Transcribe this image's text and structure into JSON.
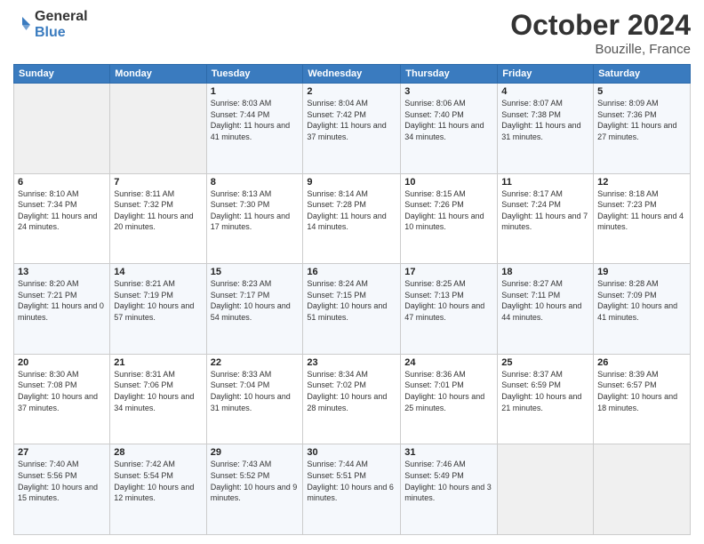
{
  "header": {
    "logo": {
      "general": "General",
      "blue": "Blue"
    },
    "title": "October 2024",
    "location": "Bouzille, France"
  },
  "weekdays": [
    "Sunday",
    "Monday",
    "Tuesday",
    "Wednesday",
    "Thursday",
    "Friday",
    "Saturday"
  ],
  "weeks": [
    [
      {
        "day": "",
        "info": ""
      },
      {
        "day": "",
        "info": ""
      },
      {
        "day": "1",
        "info": "Sunrise: 8:03 AM\nSunset: 7:44 PM\nDaylight: 11 hours and 41 minutes."
      },
      {
        "day": "2",
        "info": "Sunrise: 8:04 AM\nSunset: 7:42 PM\nDaylight: 11 hours and 37 minutes."
      },
      {
        "day": "3",
        "info": "Sunrise: 8:06 AM\nSunset: 7:40 PM\nDaylight: 11 hours and 34 minutes."
      },
      {
        "day": "4",
        "info": "Sunrise: 8:07 AM\nSunset: 7:38 PM\nDaylight: 11 hours and 31 minutes."
      },
      {
        "day": "5",
        "info": "Sunrise: 8:09 AM\nSunset: 7:36 PM\nDaylight: 11 hours and 27 minutes."
      }
    ],
    [
      {
        "day": "6",
        "info": "Sunrise: 8:10 AM\nSunset: 7:34 PM\nDaylight: 11 hours and 24 minutes."
      },
      {
        "day": "7",
        "info": "Sunrise: 8:11 AM\nSunset: 7:32 PM\nDaylight: 11 hours and 20 minutes."
      },
      {
        "day": "8",
        "info": "Sunrise: 8:13 AM\nSunset: 7:30 PM\nDaylight: 11 hours and 17 minutes."
      },
      {
        "day": "9",
        "info": "Sunrise: 8:14 AM\nSunset: 7:28 PM\nDaylight: 11 hours and 14 minutes."
      },
      {
        "day": "10",
        "info": "Sunrise: 8:15 AM\nSunset: 7:26 PM\nDaylight: 11 hours and 10 minutes."
      },
      {
        "day": "11",
        "info": "Sunrise: 8:17 AM\nSunset: 7:24 PM\nDaylight: 11 hours and 7 minutes."
      },
      {
        "day": "12",
        "info": "Sunrise: 8:18 AM\nSunset: 7:23 PM\nDaylight: 11 hours and 4 minutes."
      }
    ],
    [
      {
        "day": "13",
        "info": "Sunrise: 8:20 AM\nSunset: 7:21 PM\nDaylight: 11 hours and 0 minutes."
      },
      {
        "day": "14",
        "info": "Sunrise: 8:21 AM\nSunset: 7:19 PM\nDaylight: 10 hours and 57 minutes."
      },
      {
        "day": "15",
        "info": "Sunrise: 8:23 AM\nSunset: 7:17 PM\nDaylight: 10 hours and 54 minutes."
      },
      {
        "day": "16",
        "info": "Sunrise: 8:24 AM\nSunset: 7:15 PM\nDaylight: 10 hours and 51 minutes."
      },
      {
        "day": "17",
        "info": "Sunrise: 8:25 AM\nSunset: 7:13 PM\nDaylight: 10 hours and 47 minutes."
      },
      {
        "day": "18",
        "info": "Sunrise: 8:27 AM\nSunset: 7:11 PM\nDaylight: 10 hours and 44 minutes."
      },
      {
        "day": "19",
        "info": "Sunrise: 8:28 AM\nSunset: 7:09 PM\nDaylight: 10 hours and 41 minutes."
      }
    ],
    [
      {
        "day": "20",
        "info": "Sunrise: 8:30 AM\nSunset: 7:08 PM\nDaylight: 10 hours and 37 minutes."
      },
      {
        "day": "21",
        "info": "Sunrise: 8:31 AM\nSunset: 7:06 PM\nDaylight: 10 hours and 34 minutes."
      },
      {
        "day": "22",
        "info": "Sunrise: 8:33 AM\nSunset: 7:04 PM\nDaylight: 10 hours and 31 minutes."
      },
      {
        "day": "23",
        "info": "Sunrise: 8:34 AM\nSunset: 7:02 PM\nDaylight: 10 hours and 28 minutes."
      },
      {
        "day": "24",
        "info": "Sunrise: 8:36 AM\nSunset: 7:01 PM\nDaylight: 10 hours and 25 minutes."
      },
      {
        "day": "25",
        "info": "Sunrise: 8:37 AM\nSunset: 6:59 PM\nDaylight: 10 hours and 21 minutes."
      },
      {
        "day": "26",
        "info": "Sunrise: 8:39 AM\nSunset: 6:57 PM\nDaylight: 10 hours and 18 minutes."
      }
    ],
    [
      {
        "day": "27",
        "info": "Sunrise: 7:40 AM\nSunset: 5:56 PM\nDaylight: 10 hours and 15 minutes."
      },
      {
        "day": "28",
        "info": "Sunrise: 7:42 AM\nSunset: 5:54 PM\nDaylight: 10 hours and 12 minutes."
      },
      {
        "day": "29",
        "info": "Sunrise: 7:43 AM\nSunset: 5:52 PM\nDaylight: 10 hours and 9 minutes."
      },
      {
        "day": "30",
        "info": "Sunrise: 7:44 AM\nSunset: 5:51 PM\nDaylight: 10 hours and 6 minutes."
      },
      {
        "day": "31",
        "info": "Sunrise: 7:46 AM\nSunset: 5:49 PM\nDaylight: 10 hours and 3 minutes."
      },
      {
        "day": "",
        "info": ""
      },
      {
        "day": "",
        "info": ""
      }
    ]
  ]
}
